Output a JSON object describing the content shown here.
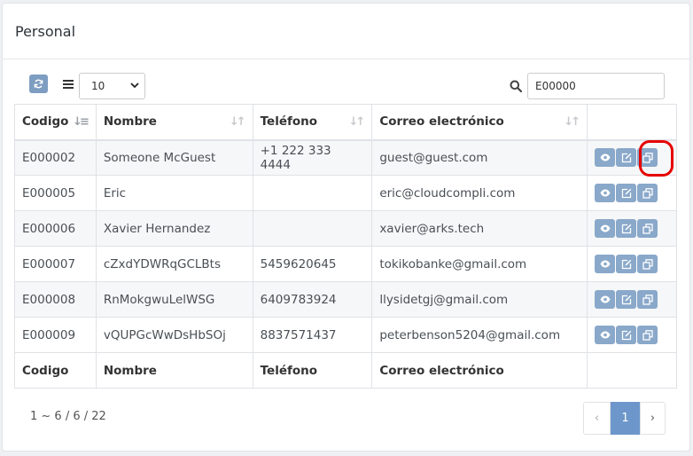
{
  "panel": {
    "title": "Personal"
  },
  "toolbar": {
    "page_size": "10",
    "search_value": "E00000"
  },
  "table": {
    "headers": [
      "Codigo",
      "Nombre",
      "Teléfono",
      "Correo electrónico"
    ],
    "rows": [
      {
        "codigo": "E000002",
        "nombre": "Someone McGuest",
        "telefono": "+1 222 333 4444",
        "correo": "guest@guest.com"
      },
      {
        "codigo": "E000005",
        "nombre": "Eric",
        "telefono": "",
        "correo": "eric@cloudcompli.com"
      },
      {
        "codigo": "E000006",
        "nombre": "Xavier Hernandez",
        "telefono": "",
        "correo": "xavier@arks.tech"
      },
      {
        "codigo": "E000007",
        "nombre": "cZxdYDWRqGCLBts",
        "telefono": "5459620645",
        "correo": "tokikobanke@gmail.com"
      },
      {
        "codigo": "E000008",
        "nombre": "RnMokgwuLelWSG",
        "telefono": "6409783924",
        "correo": "llysidetgj@gmail.com"
      },
      {
        "codigo": "E000009",
        "nombre": "vQUPGcWwDsHbSOj",
        "telefono": "8837571437",
        "correo": "peterbenson5204@gmail.com"
      }
    ],
    "footer": [
      "Codigo",
      "Nombre",
      "Teléfono",
      "Correo electrónico"
    ]
  },
  "pagination": {
    "info": "1 ~ 6 / 6 / 22",
    "prev": "‹",
    "current": "1",
    "next": "›"
  },
  "colors": {
    "accent": "#6d97cb",
    "action_button": "#89a8ca",
    "highlight": "#e60000"
  },
  "icons": [
    "refresh-icon",
    "list-icon",
    "chevron-down-icon",
    "search-icon",
    "sort-icon",
    "eye-icon",
    "edit-icon",
    "copy-icon"
  ]
}
